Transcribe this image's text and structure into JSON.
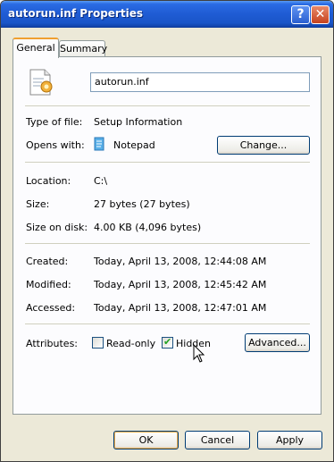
{
  "window": {
    "title": "autorun.inf Properties"
  },
  "titlebar_buttons": {
    "help": "?",
    "close": "✕"
  },
  "tabs": [
    {
      "label": "General"
    },
    {
      "label": "Summary"
    }
  ],
  "general": {
    "file_name": "autorun.inf",
    "rows": {
      "type": {
        "label": "Type of file:",
        "value": "Setup Information"
      },
      "opens": {
        "label": "Opens with:",
        "value": "Notepad",
        "button": "Change..."
      },
      "location": {
        "label": "Location:",
        "value": "C:\\"
      },
      "size": {
        "label": "Size:",
        "value": "27 bytes (27 bytes)"
      },
      "size_on_disk": {
        "label": "Size on disk:",
        "value": "4.00 KB (4,096 bytes)"
      },
      "created": {
        "label": "Created:",
        "value": "Today, April 13, 2008, 12:44:08 AM"
      },
      "modified": {
        "label": "Modified:",
        "value": "Today, April 13, 2008, 12:45:42 AM"
      },
      "accessed": {
        "label": "Accessed:",
        "value": "Today, April 13, 2008, 12:47:01 AM"
      }
    },
    "attributes": {
      "label": "Attributes:",
      "readonly": {
        "label": "Read-only",
        "checked": false
      },
      "hidden": {
        "label": "Hidden",
        "checked": true
      },
      "advanced": "Advanced..."
    }
  },
  "footer": {
    "ok": "OK",
    "cancel": "Cancel",
    "apply": "Apply"
  }
}
